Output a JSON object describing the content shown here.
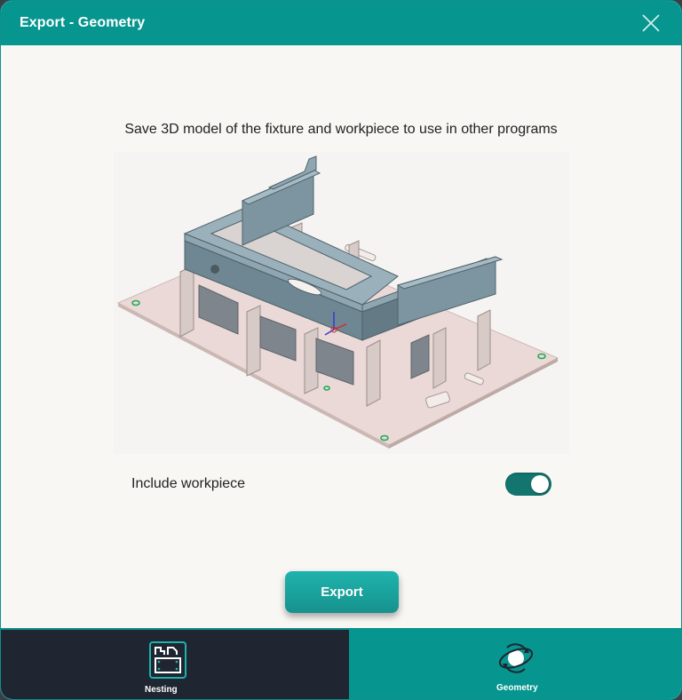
{
  "dialog": {
    "title": "Export - Geometry",
    "close_icon": "close-icon"
  },
  "main": {
    "description": "Save 3D model of the fixture and workpiece to use in other programs",
    "preview_image": "fixture-3d-model",
    "include_workpiece": {
      "label": "Include workpiece",
      "enabled": true
    },
    "export_label": "Export"
  },
  "tabs": [
    {
      "label": "Nesting",
      "icon": "nesting-icon",
      "active": false
    },
    {
      "label": "Geometry",
      "icon": "geometry-rotate-icon",
      "active": true
    }
  ],
  "colors": {
    "accent": "#07958f",
    "toggle_on": "#12766f",
    "dark_tab": "#1f2632"
  }
}
